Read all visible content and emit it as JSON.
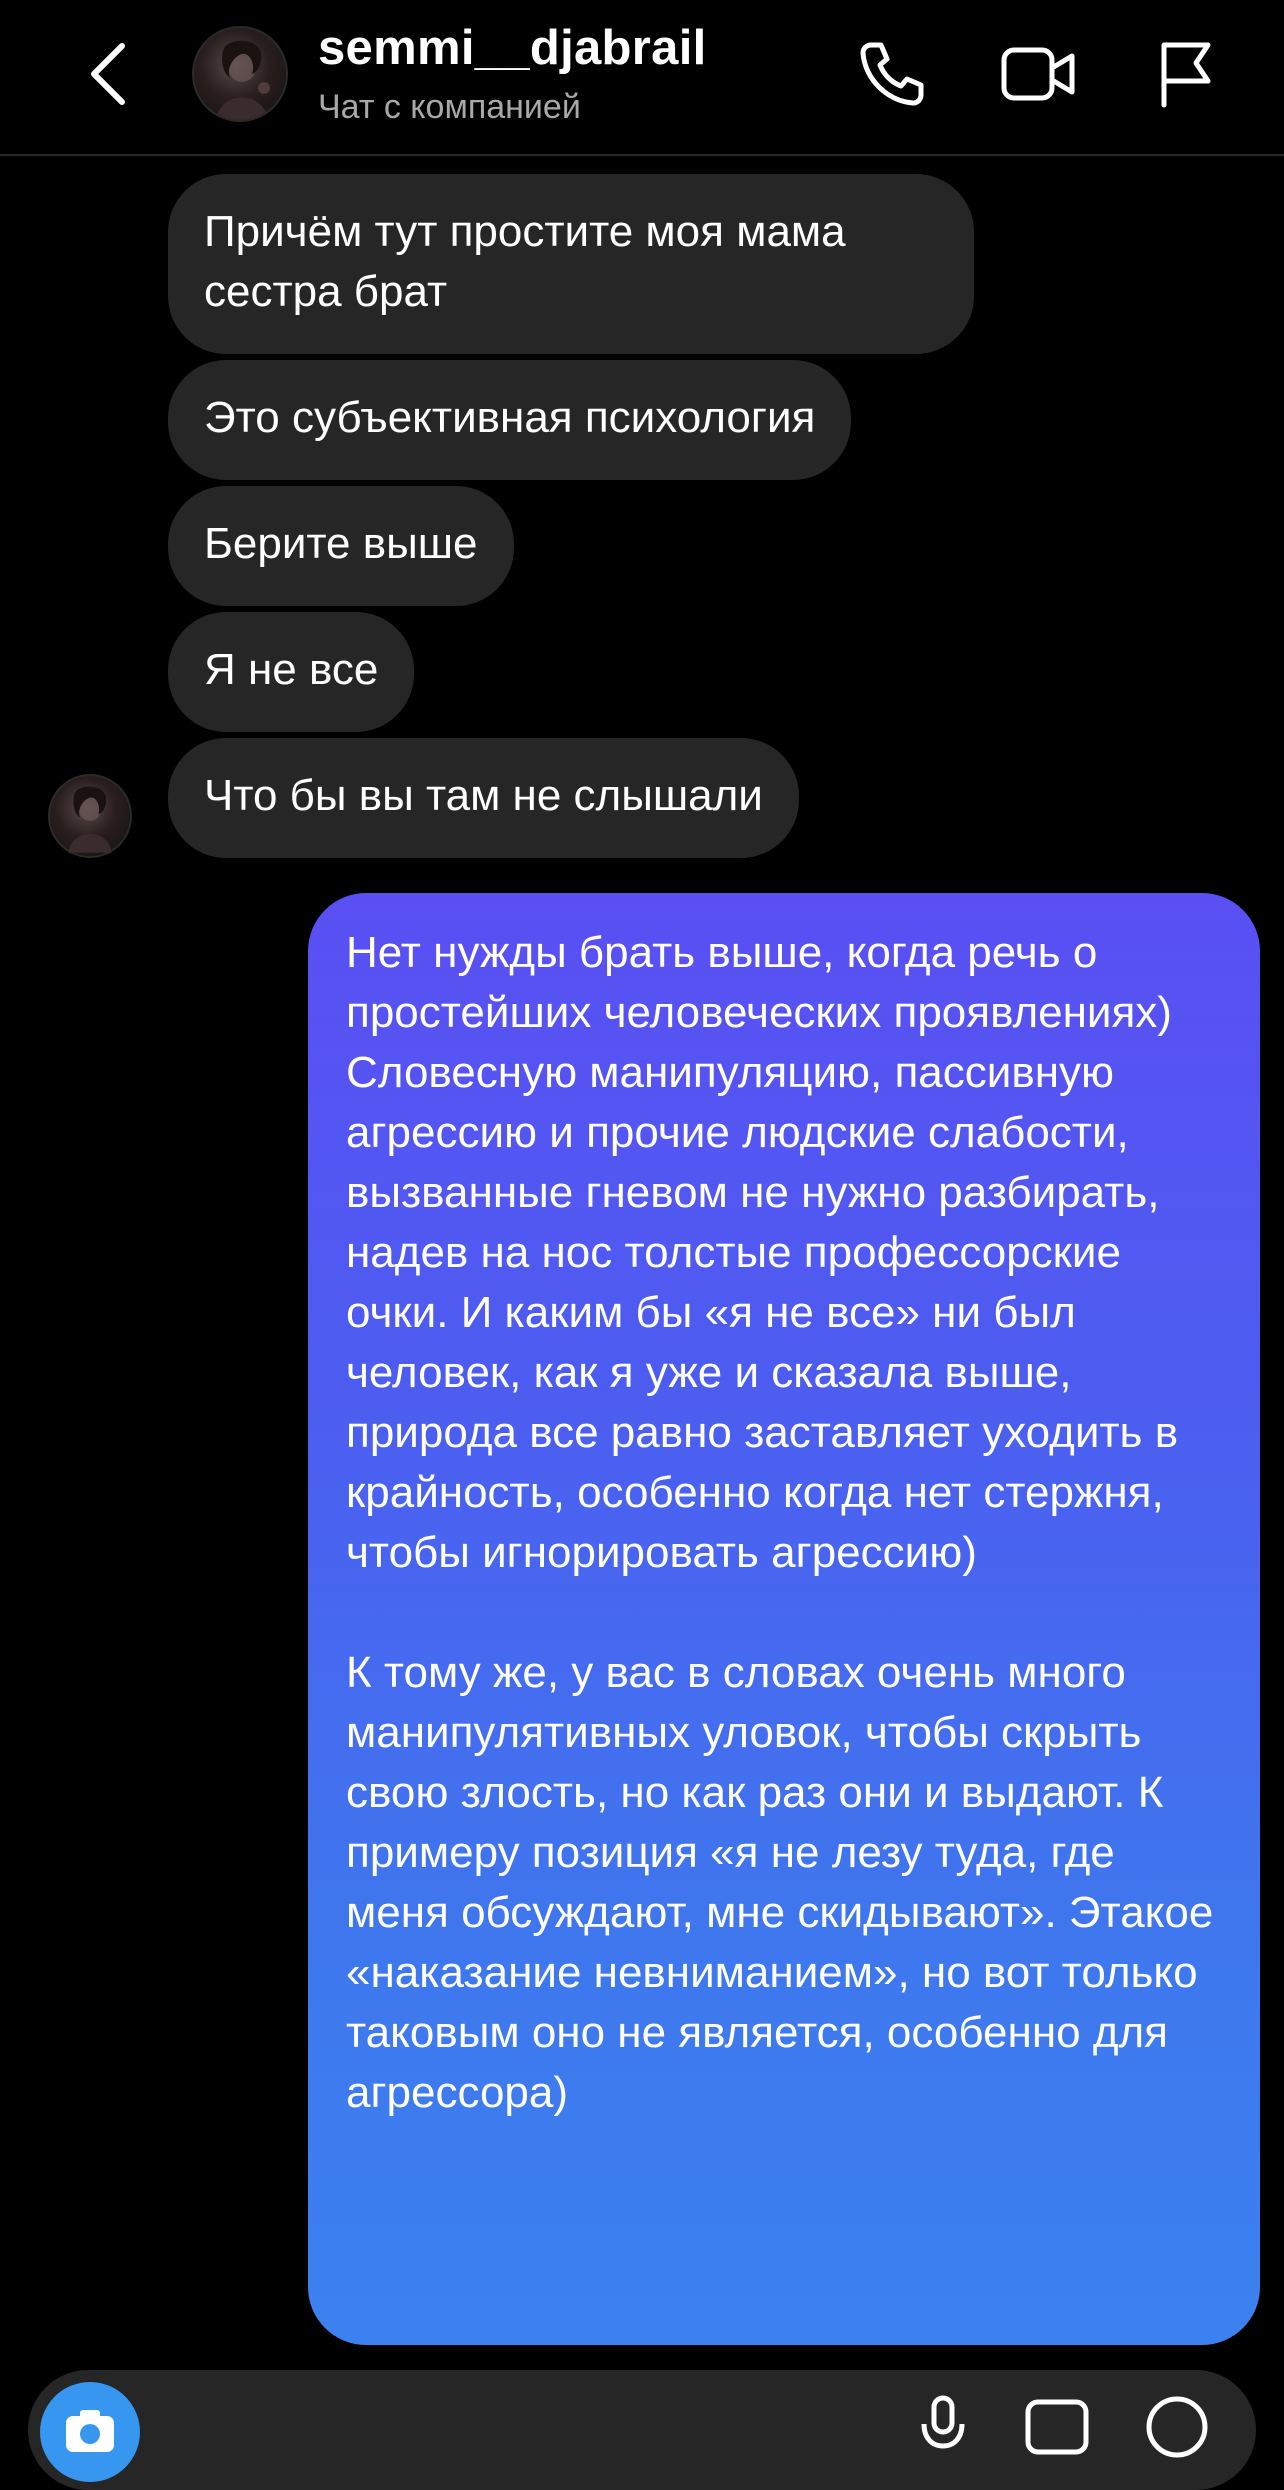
{
  "header": {
    "username": "semmi__djabrail",
    "subtitle": "Чат с компанией"
  },
  "icons": {
    "back": "chevron-left-icon",
    "call": "phone-icon",
    "video": "video-camera-icon",
    "report": "flag-icon"
  },
  "messages_in": [
    {
      "lines": [
        "Причём тут простите моя мама",
        "сестра брат"
      ]
    },
    {
      "text": "Это субъективная психология"
    },
    {
      "text": "Берите выше"
    },
    {
      "text": "Я не все"
    },
    {
      "text": "Что бы вы там не слышали"
    }
  ],
  "message_out": {
    "paragraph_1": "Нет нужды брать выше, когда речь о простейших человеческих проявлениях) Словесную манипуляцию, пассивную агрессию и прочие людские слабости, вызванные гневом не нужно разбирать, надев на нос толстые профессорские очки. И каким бы «я не все» ни был человек, как я уже и сказала выше, природа все равно заставляет уходить в крайность, особенно когда нет стержня, чтобы игнорировать агрессию)",
    "paragraph_2": "К тому же, у вас в словах очень много манипулятивных уловок, чтобы скрыть свою злость, но как раз они и выдают. К примеру позиция «я не лезу туда, где меня обсуждают, мне скидывают». Этакое «наказание невниманием», но вот только таковым оно не является, особенно для агрессора)"
  },
  "colors": {
    "background": "#000000",
    "incoming_bubble": "#262626",
    "outgoing_gradient_top": "#5a4ff3",
    "outgoing_gradient_bottom": "#3b82f0",
    "secondary_text": "#a8a8a8",
    "camera_button": "#3797f0"
  }
}
